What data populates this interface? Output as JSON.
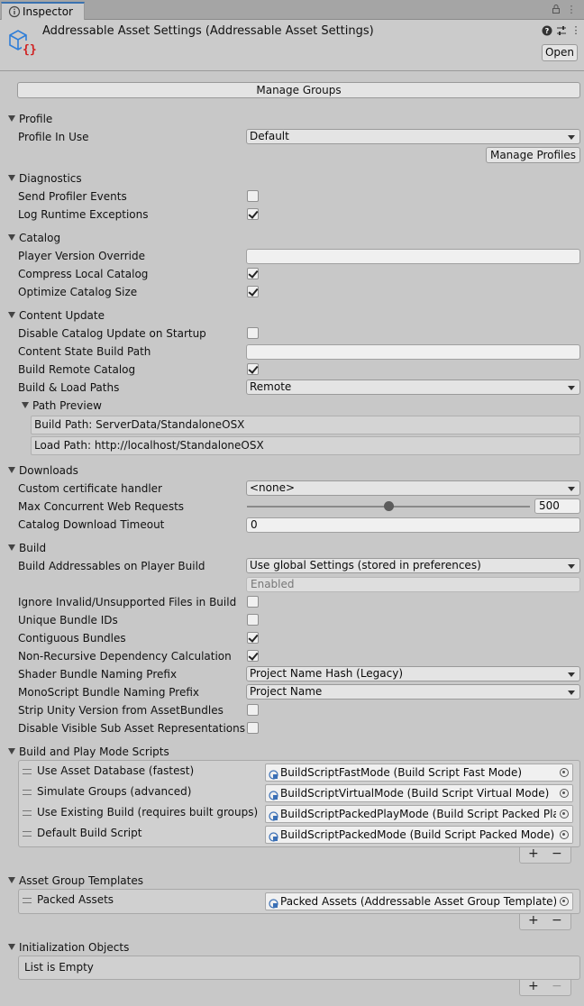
{
  "tab": {
    "label": "Inspector"
  },
  "header": {
    "title": "Addressable Asset Settings (Addressable Asset Settings)",
    "open_label": "Open"
  },
  "manage_groups_label": "Manage Groups",
  "profile": {
    "section": "Profile",
    "profile_in_use_label": "Profile In Use",
    "profile_in_use_value": "Default",
    "manage_profiles_label": "Manage Profiles"
  },
  "diagnostics": {
    "section": "Diagnostics",
    "send_profiler_events_label": "Send Profiler Events",
    "send_profiler_events": false,
    "log_runtime_exceptions_label": "Log Runtime Exceptions",
    "log_runtime_exceptions": true
  },
  "catalog": {
    "section": "Catalog",
    "player_version_override_label": "Player Version Override",
    "player_version_override": "",
    "compress_local_catalog_label": "Compress Local Catalog",
    "compress_local_catalog": true,
    "optimize_catalog_size_label": "Optimize Catalog Size",
    "optimize_catalog_size": true
  },
  "content_update": {
    "section": "Content Update",
    "disable_catalog_update_label": "Disable Catalog Update on Startup",
    "disable_catalog_update": false,
    "content_state_build_path_label": "Content State Build Path",
    "content_state_build_path": "",
    "build_remote_catalog_label": "Build Remote Catalog",
    "build_remote_catalog": true,
    "build_load_paths_label": "Build & Load Paths",
    "build_load_paths_value": "Remote",
    "path_preview_label": "Path Preview",
    "build_path": "Build Path: ServerData/StandaloneOSX",
    "load_path": "Load Path: http://localhost/StandaloneOSX"
  },
  "downloads": {
    "section": "Downloads",
    "cert_handler_label": "Custom certificate handler",
    "cert_handler_value": "<none>",
    "max_concurrent_label": "Max Concurrent Web Requests",
    "max_concurrent_value": "500",
    "max_concurrent_fraction": 0.5,
    "catalog_timeout_label": "Catalog Download Timeout",
    "catalog_timeout_value": "0"
  },
  "build": {
    "section": "Build",
    "build_on_player_label": "Build Addressables on Player Build",
    "build_on_player_value": "Use global Settings (stored in preferences)",
    "build_on_player_sub": "Enabled",
    "ignore_invalid_label": "Ignore Invalid/Unsupported Files in Build",
    "ignore_invalid": false,
    "unique_bundle_ids_label": "Unique Bundle IDs",
    "unique_bundle_ids": false,
    "contiguous_bundles_label": "Contiguous Bundles",
    "contiguous_bundles": true,
    "non_recursive_label": "Non-Recursive Dependency Calculation",
    "non_recursive": true,
    "shader_prefix_label": "Shader Bundle Naming Prefix",
    "shader_prefix_value": "Project Name Hash (Legacy)",
    "mono_prefix_label": "MonoScript Bundle Naming Prefix",
    "mono_prefix_value": "Project Name",
    "strip_unity_version_label": "Strip Unity Version from AssetBundles",
    "strip_unity_version": false,
    "disable_sub_asset_label": "Disable Visible Sub Asset Representations",
    "disable_sub_asset": false
  },
  "scripts": {
    "section": "Build and Play Mode Scripts",
    "items": [
      {
        "label": "Use Asset Database (fastest)",
        "value": "BuildScriptFastMode (Build Script Fast Mode)"
      },
      {
        "label": "Simulate Groups (advanced)",
        "value": "BuildScriptVirtualMode (Build Script Virtual Mode)"
      },
      {
        "label": "Use Existing Build (requires built groups)",
        "value": "BuildScriptPackedPlayMode (Build Script Packed Play"
      },
      {
        "label": "Default Build Script",
        "value": "BuildScriptPackedMode (Build Script Packed Mode)"
      }
    ]
  },
  "templates": {
    "section": "Asset Group Templates",
    "items": [
      {
        "label": "Packed Assets",
        "value": "Packed Assets (Addressable Asset Group Template)"
      }
    ]
  },
  "init_objects": {
    "section": "Initialization Objects",
    "empty_label": "List is Empty"
  },
  "list_controls": {
    "plus": "+",
    "minus": "−"
  }
}
